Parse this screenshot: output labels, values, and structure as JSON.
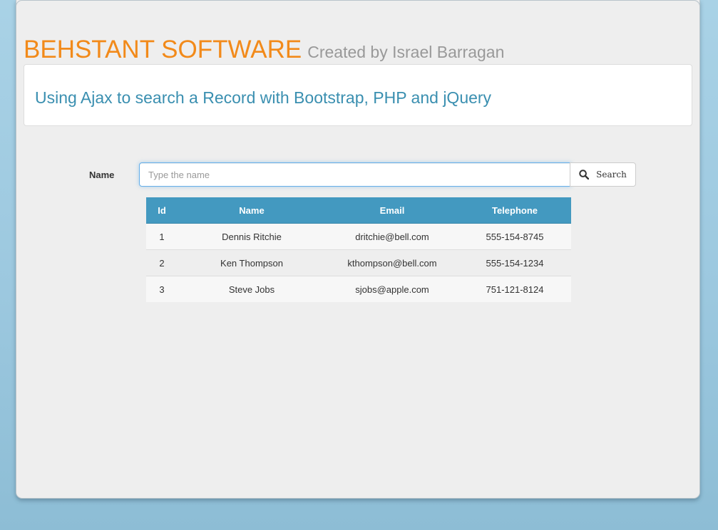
{
  "header": {
    "brand": "BEHSTANT SOFTWARE",
    "tagline": "Created by Israel Barragan"
  },
  "panel": {
    "title": "Using Ajax to search a Record with Bootstrap, PHP and jQuery"
  },
  "search": {
    "label": "Name",
    "placeholder": "Type the name",
    "value": "",
    "button_label": "Search",
    "button_icon": "search-icon"
  },
  "table": {
    "headers": [
      "Id",
      "Name",
      "Email",
      "Telephone"
    ],
    "rows": [
      [
        "1",
        "Dennis Ritchie",
        "dritchie@bell.com",
        "555-154-8745"
      ],
      [
        "2",
        "Ken Thompson",
        "kthompson@bell.com",
        "555-154-1234"
      ],
      [
        "3",
        "Steve Jobs",
        "sjobs@apple.com",
        "751-121-8124"
      ]
    ]
  },
  "colors": {
    "brand": "#f28a1a",
    "tagline": "#999999",
    "panel_title": "#3a8fb0",
    "table_header": "#4399c0"
  }
}
